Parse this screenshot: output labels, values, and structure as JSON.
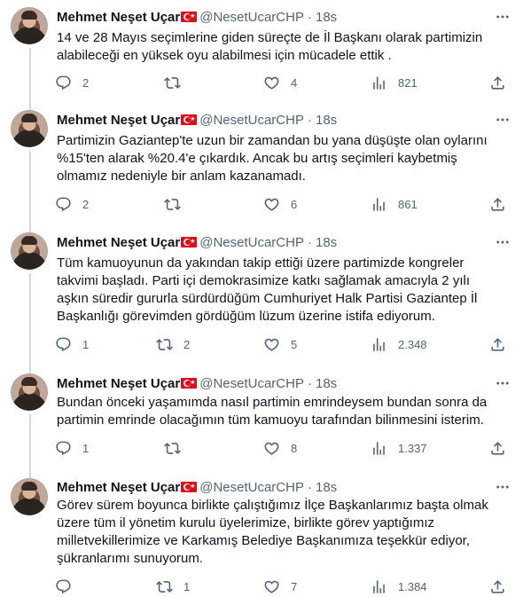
{
  "author": {
    "name": "Mehmet Neşet Uçar",
    "handle": "@NesetUcarCHP",
    "separator": "·",
    "time": "18s"
  },
  "colors": {
    "flag_red": "#e30a17",
    "text": "#0f1419",
    "muted": "#536471"
  },
  "icons": [
    "reply-icon",
    "retweet-icon",
    "like-icon",
    "views-icon",
    "share-icon",
    "more-icon",
    "turkish-flag-icon"
  ],
  "tweets": [
    {
      "lines": [
        "14 ve 28 Mayıs seçimlerine giden süreçte de İl Başkanı olarak partimizin",
        "alabileceği en yüksek oyu alabilmesi için mücadele ettik ."
      ],
      "replies": "2",
      "retweets": "",
      "likes": "4",
      "views": "821"
    },
    {
      "lines": [
        "Partimizin Gaziantep'te uzun bir zamandan bu yana düşüşte olan oylarını",
        "%15'ten alarak %20.4'e çıkardık. Ancak bu artış seçimleri kaybetmiş",
        "olmamız nedeniyle bir anlam kazanamadı."
      ],
      "replies": "2",
      "retweets": "",
      "likes": "6",
      "views": "861"
    },
    {
      "lines": [
        "Tüm kamuoyunun da yakından takip ettiği üzere partimizde kongreler",
        "takvimi başladı. Parti içi demokrasimize katkı sağlamak amacıyla 2 yılı",
        "aşkın süredir gururla sürdürdüğüm Cumhuriyet Halk Partisi Gaziantep İl",
        "Başkanlığı görevimden gördüğüm lüzum üzerine istifa ediyorum."
      ],
      "replies": "1",
      "retweets": "2",
      "likes": "5",
      "views": "2.348"
    },
    {
      "lines": [
        "Bundan önceki yaşamımda nasıl partimin emrindeysem bundan sonra da",
        "partimin emrinde olacağımın tüm kamuoyu tarafından bilinmesini isterim."
      ],
      "replies": "1",
      "retweets": "",
      "likes": "8",
      "views": "1.337"
    },
    {
      "lines": [
        "Görev sürem boyunca birlikte çalıştığımız İlçe Başkanlarımız başta olmak",
        "üzere tüm il yönetim kurulu üyelerimize, birlikte görev yaptığımız",
        "milletvekillerimize ve Karkamış Belediye Başkanımıza teşekkür ediyor,",
        "şükranlarımı sunuyorum."
      ],
      "replies": "",
      "retweets": "1",
      "likes": "7",
      "views": "1.384"
    }
  ]
}
